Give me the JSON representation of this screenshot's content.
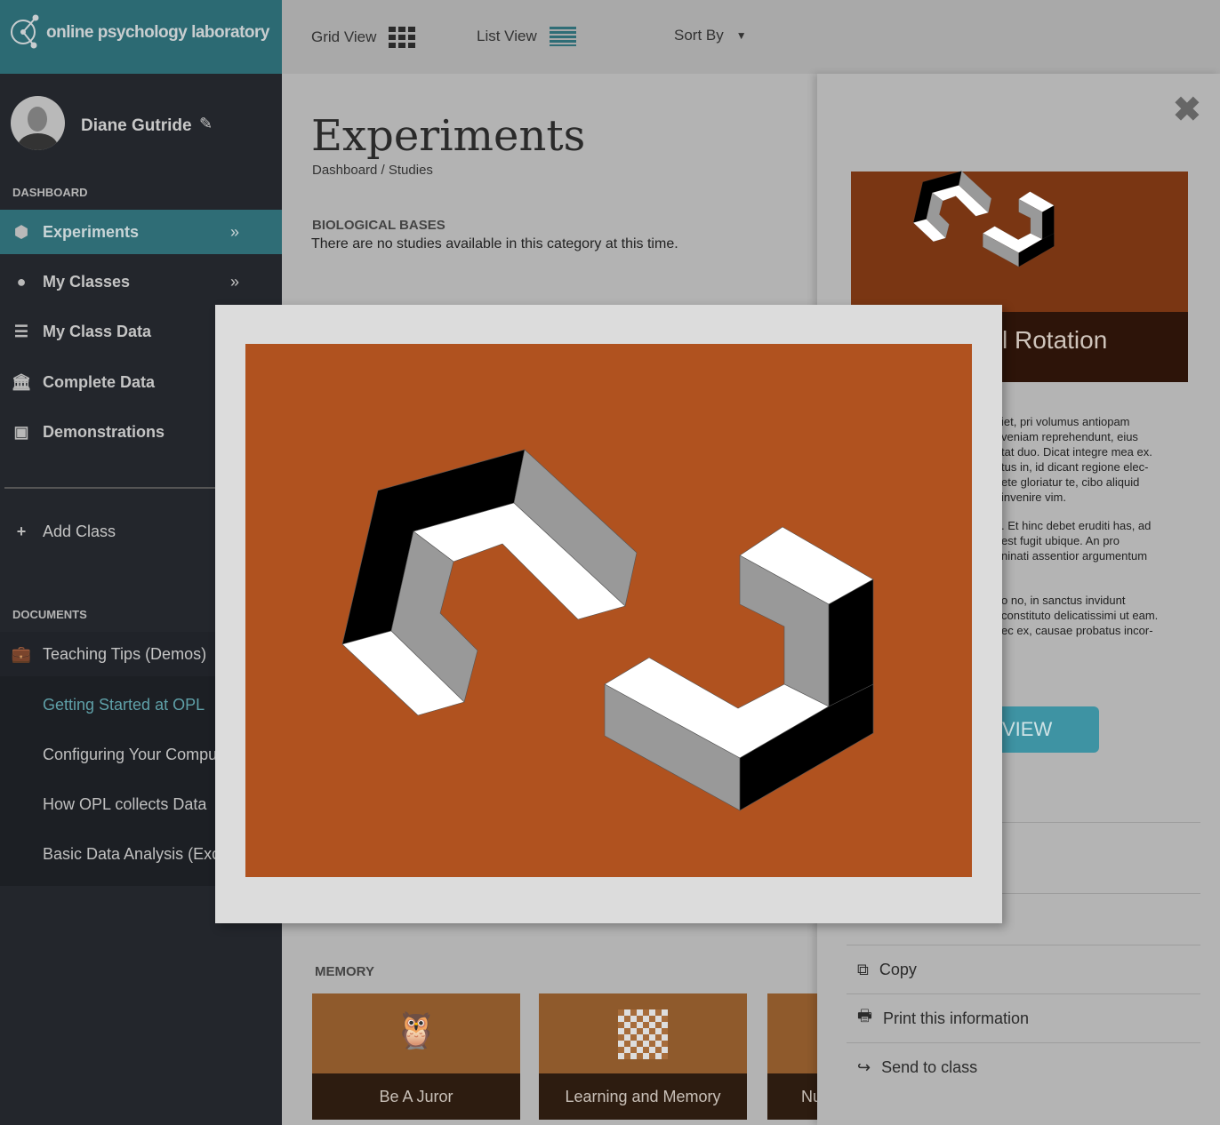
{
  "app": {
    "logo_text": "online psychology laboratory"
  },
  "user": {
    "name": "Diane Gutride"
  },
  "sidebar": {
    "dashboard_heading": "DASHBOARD",
    "items": [
      {
        "label": "Experiments",
        "icon": "cube-icon",
        "active": true
      },
      {
        "label": "My Classes",
        "icon": "apple-icon"
      },
      {
        "label": "My Class Data",
        "icon": "database-icon"
      },
      {
        "label": "Complete Data",
        "icon": "bank-icon"
      },
      {
        "label": "Demonstrations",
        "icon": "play-square-icon"
      }
    ],
    "add_class": "Add Class",
    "documents_heading": "DOCUMENTS",
    "teaching_tips": "Teaching Tips (Demos)",
    "documents": [
      "Getting Started at OPL",
      "Configuring Your Compu",
      "How OPL collects Data",
      "Basic Data Analysis (Exc"
    ]
  },
  "toolbar": {
    "grid_view": "Grid View",
    "list_view": "List View",
    "sort_by": "Sort By"
  },
  "main": {
    "title": "Experiments",
    "breadcrumb": "Dashboard / Studies",
    "bio_heading": "BIOLOGICAL BASES",
    "bio_empty": "There are no studies available in this category at this time.",
    "memory_heading": "MEMORY",
    "cards": [
      "Be A Juror",
      "Learning and Memory",
      "Nu"
    ]
  },
  "panel": {
    "title_fragment": "l Rotation",
    "paragraphs": [
      [
        "iet, pri volumus antiopam",
        "veniam reprehendunt, eius",
        "tat duo. Dicat integre mea ex.",
        "tus in, id dicant regione elec-",
        "ete gloriatur te, cibo aliquid",
        "invenire vim."
      ],
      [
        ". Et hinc debet eruditi has, ad",
        "est fugit ubique. An pro",
        "ninati assentior argumentum"
      ],
      [
        "o no, in sanctus invidunt",
        "constituto delicatissimi ut eam.",
        "ec ex, causae probatus incor-"
      ]
    ],
    "view_button": "VIEW",
    "actions": [
      {
        "label": "Copy",
        "icon": "copy-icon"
      },
      {
        "label": "Print this information",
        "icon": "print-icon"
      },
      {
        "label": "Send to class",
        "icon": "share-icon"
      }
    ]
  },
  "colors": {
    "accent": "#2f6d76",
    "sidebar": "#23262c",
    "image_bg": "#b0521f",
    "view_button": "#3e93a3"
  }
}
